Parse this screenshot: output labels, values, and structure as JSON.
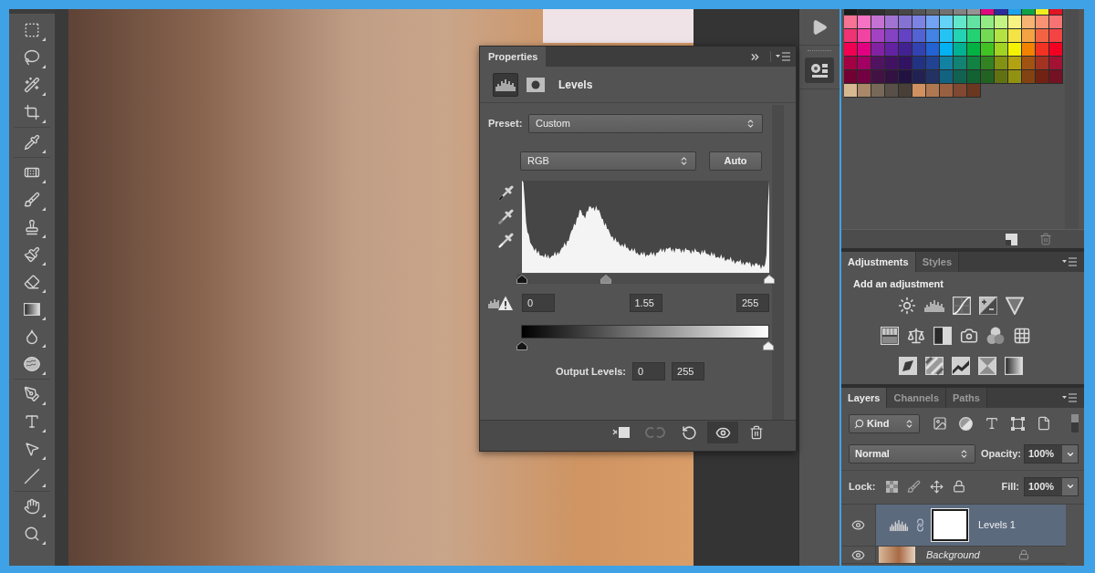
{
  "properties": {
    "tab": "Properties",
    "type_buttons": [
      {
        "kind": "levels",
        "selected": true
      },
      {
        "kind": "mask",
        "selected": false
      }
    ],
    "title": "Levels",
    "preset_label": "Preset:",
    "preset": "Custom",
    "channel": "RGB",
    "auto_button": "Auto",
    "input_handles": [
      {
        "level": 0
      },
      {
        "level": 0.34
      },
      {
        "level": 1
      }
    ],
    "input_values": [
      "0",
      "1.55",
      "255"
    ],
    "output_handles": [
      {
        "level": 0
      },
      {
        "level": 1
      }
    ],
    "output_label": "Output Levels:",
    "output_values": [
      "0",
      "255"
    ],
    "footer_buttons": [
      {
        "kind": "clip",
        "disabled": false,
        "pressed": false
      },
      {
        "kind": "previous",
        "disabled": true,
        "pressed": false
      },
      {
        "kind": "reset",
        "disabled": false,
        "pressed": false
      },
      {
        "kind": "visibility",
        "disabled": false,
        "pressed": true
      },
      {
        "kind": "delete",
        "disabled": false,
        "pressed": false
      }
    ]
  },
  "swatches": {
    "rows": [
      {
        "swatches": [
          {
            "color": "#1c1c1c"
          },
          {
            "color": "#262626"
          },
          {
            "color": "#303030"
          },
          {
            "color": "#3a3a3a"
          },
          {
            "color": "#474747"
          },
          {
            "color": "#555555"
          },
          {
            "color": "#636363"
          },
          {
            "color": "#727272"
          },
          {
            "color": "#838383"
          },
          {
            "color": "#959595"
          },
          {
            "color": "#e0087c"
          },
          {
            "color": "#2c2c9c"
          },
          {
            "color": "#1ca2ea"
          },
          {
            "color": "#12a246"
          },
          {
            "color": "#eeee22"
          },
          {
            "color": "#e01424"
          }
        ]
      },
      {
        "swatches": [
          {
            "color": "#f77393"
          },
          {
            "color": "#f673c3"
          },
          {
            "color": "#c473d3"
          },
          {
            "color": "#a373d3"
          },
          {
            "color": "#8473d3"
          },
          {
            "color": "#7c83e3"
          },
          {
            "color": "#73a3f3"
          },
          {
            "color": "#63d3f7"
          },
          {
            "color": "#63e7cb"
          },
          {
            "color": "#63e3a3"
          },
          {
            "color": "#93eb83"
          },
          {
            "color": "#c3f383"
          },
          {
            "color": "#f7f383"
          },
          {
            "color": "#f7b373"
          },
          {
            "color": "#f79373"
          },
          {
            "color": "#f77373"
          }
        ]
      },
      {
        "swatches": [
          {
            "color": "#f03372"
          },
          {
            "color": "#f043a2"
          },
          {
            "color": "#a343c3"
          },
          {
            "color": "#8343c3"
          },
          {
            "color": "#6343c3"
          },
          {
            "color": "#5363d3"
          },
          {
            "color": "#4383e3"
          },
          {
            "color": "#23c3f3"
          },
          {
            "color": "#23d3b3"
          },
          {
            "color": "#23d373"
          },
          {
            "color": "#73db53"
          },
          {
            "color": "#b3e343"
          },
          {
            "color": "#f3e343"
          },
          {
            "color": "#f3a343"
          },
          {
            "color": "#f36343"
          },
          {
            "color": "#f34343"
          }
        ]
      },
      {
        "swatches": [
          {
            "color": "#f20052"
          },
          {
            "color": "#e20082"
          },
          {
            "color": "#8222a2"
          },
          {
            "color": "#6222a2"
          },
          {
            "color": "#422292"
          },
          {
            "color": "#3242b2"
          },
          {
            "color": "#2262d2"
          },
          {
            "color": "#02b2f2"
          },
          {
            "color": "#02b292"
          },
          {
            "color": "#02b242"
          },
          {
            "color": "#42c222"
          },
          {
            "color": "#a2d222"
          },
          {
            "color": "#f2f202"
          },
          {
            "color": "#f28202"
          },
          {
            "color": "#f23222"
          },
          {
            "color": "#f20022"
          }
        ]
      },
      {
        "swatches": [
          {
            "color": "#a20042"
          },
          {
            "color": "#a20062"
          },
          {
            "color": "#521262"
          },
          {
            "color": "#421262"
          },
          {
            "color": "#321262"
          },
          {
            "color": "#223282"
          },
          {
            "color": "#224292"
          },
          {
            "color": "#1282a2"
          },
          {
            "color": "#128272"
          },
          {
            "color": "#128242"
          },
          {
            "color": "#328222"
          },
          {
            "color": "#829212"
          },
          {
            "color": "#b2a212"
          },
          {
            "color": "#a25212"
          },
          {
            "color": "#a23222"
          },
          {
            "color": "#a21232"
          }
        ]
      },
      {
        "swatches": [
          {
            "color": "#720032"
          },
          {
            "color": "#720042"
          },
          {
            "color": "#421242"
          },
          {
            "color": "#321242"
          },
          {
            "color": "#221242"
          },
          {
            "color": "#222252"
          },
          {
            "color": "#223262"
          },
          {
            "color": "#126282"
          },
          {
            "color": "#126252"
          },
          {
            "color": "#126232"
          },
          {
            "color": "#226222"
          },
          {
            "color": "#627212"
          },
          {
            "color": "#929212"
          },
          {
            "color": "#824212"
          },
          {
            "color": "#722212"
          },
          {
            "color": "#721222"
          }
        ]
      },
      {
        "swatches": [
          {
            "color": "#d8b890"
          },
          {
            "color": "#a88868"
          },
          {
            "color": "#786858"
          },
          {
            "color": "#585048"
          },
          {
            "color": "#484038"
          },
          {
            "color": "#d09060"
          },
          {
            "color": "#b07850"
          },
          {
            "color": "#986040"
          },
          {
            "color": "#804830"
          },
          {
            "color": "#6a3820"
          }
        ]
      }
    ]
  },
  "adjustments": {
    "tabs": [
      {
        "label": "Adjustments",
        "selected": true
      },
      {
        "label": "Styles",
        "selected": false
      }
    ],
    "heading": "Add an adjustment"
  },
  "layers_panel": {
    "tabs": [
      {
        "label": "Layers",
        "selected": true
      },
      {
        "label": "Channels",
        "selected": false
      },
      {
        "label": "Paths",
        "selected": false
      }
    ],
    "filter": "Kind",
    "blend_mode": "Normal",
    "opacity_label": "Opacity:",
    "opacity": "100%",
    "lock_label": "Lock:",
    "fill_label": "Fill:",
    "fill": "100%",
    "layers": [
      {
        "name": "Levels 1",
        "kind": "adjustment",
        "selected": true,
        "visible": true
      },
      {
        "name": "Background",
        "kind": "background",
        "selected": false,
        "visible": true
      }
    ]
  }
}
